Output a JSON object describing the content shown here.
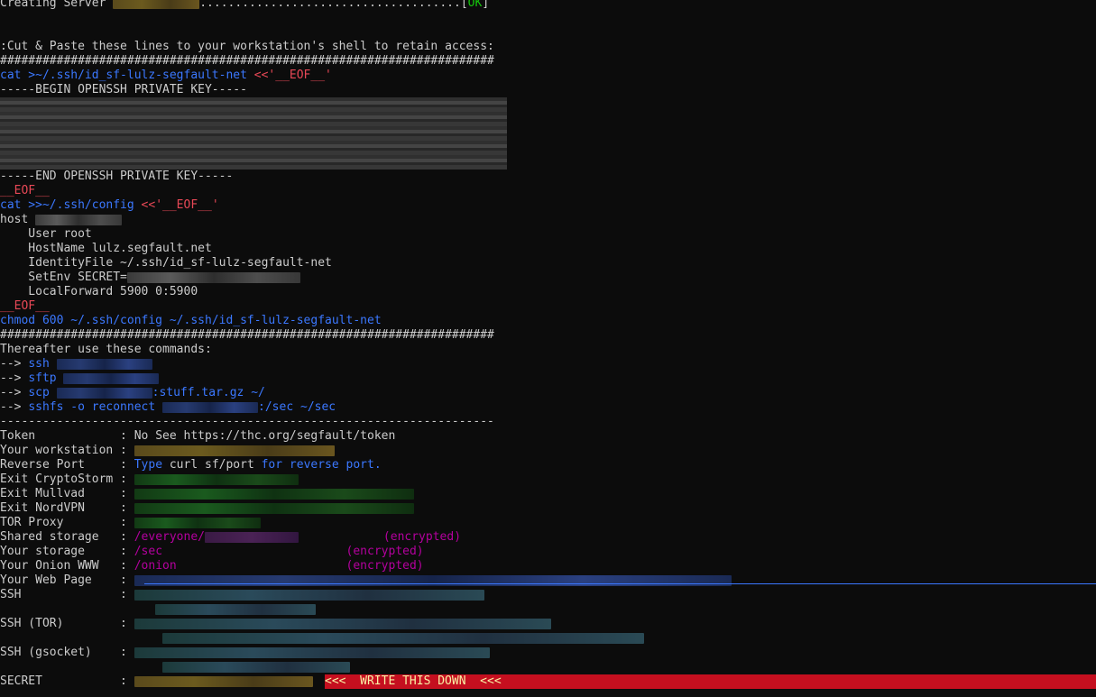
{
  "header": {
    "creating_prefix": "Creating Server ",
    "creating_dots": ".....................................[",
    "ok": "OK",
    "creating_close": "]",
    "cut_paste": ":Cut & Paste these lines to your workstation's shell to retain access:",
    "hashes": "######################################################################"
  },
  "key_section": {
    "cat_key": "cat >~/.ssh/id_sf-lulz-segfault-net ",
    "heredoc": "<<'__EOF__'",
    "begin": "-----BEGIN OPENSSH PRIVATE KEY-----",
    "end": "-----END OPENSSH PRIVATE KEY-----",
    "eof": "__EOF__",
    "cat_config": "cat >>~/.ssh/config ",
    "host": "host ",
    "user": "    User root",
    "hostname": "    HostName lulz.segfault.net",
    "identity": "    IdentityFile ~/.ssh/id_sf-lulz-segfault-net",
    "setenv": "    SetEnv SECRET=",
    "localforward": "    LocalForward 5900 0:5900",
    "chmod": "chmod 600 ~/.ssh/config ~/.ssh/id_sf-lulz-segfault-net"
  },
  "commands": {
    "intro": "Thereafter use these commands:",
    "arrow": "--> ",
    "ssh": "ssh",
    "sftp": "sftp",
    "scp": "scp",
    "scp_suffix": ":stuff.tar.gz ~/",
    "sshfs": "sshfs -o reconnect",
    "sshfs_suffix": ":/sec ~/sec",
    "dashes": "----------------------------------------------------------------------"
  },
  "info": {
    "token_label": "Token            : ",
    "token_value": "No See https://thc.org/segfault/token",
    "workstation_label": "Your workstation : ",
    "reverse_label": "Reverse Port     : ",
    "reverse_type": "Type ",
    "reverse_cmd": "curl sf/port",
    "reverse_rest": " for reverse port.",
    "cryptostorm_label": "Exit CryptoStorm : ",
    "mullvad_label": "Exit Mullvad     : ",
    "nordvpn_label": "Exit NordVPN     : ",
    "tor_label": "TOR Proxy        : ",
    "shared_label": "Shared storage   : ",
    "shared_path": "/everyone/",
    "encrypted": "(encrypted)",
    "your_storage_label": "Your storage     : ",
    "your_storage_path": "/sec",
    "onion_label": "Your Onion WWW   : ",
    "onion_path": "/onion",
    "webpage_label": "Your Web Page    : ",
    "ssh_label": "SSH              : ",
    "ssh_tor_label": "SSH (TOR)        : ",
    "ssh_gsocket_label": "SSH (gsocket)    : ",
    "secret_label": "SECRET           : ",
    "write_down": "<<<  WRITE THIS DOWN  <<<"
  },
  "colors": {
    "background": "#0c0c0c",
    "text": "#cccccc",
    "blue": "#3b78ff",
    "red": "#e74856",
    "green": "#16c60c",
    "banner": "#c50f1f"
  }
}
